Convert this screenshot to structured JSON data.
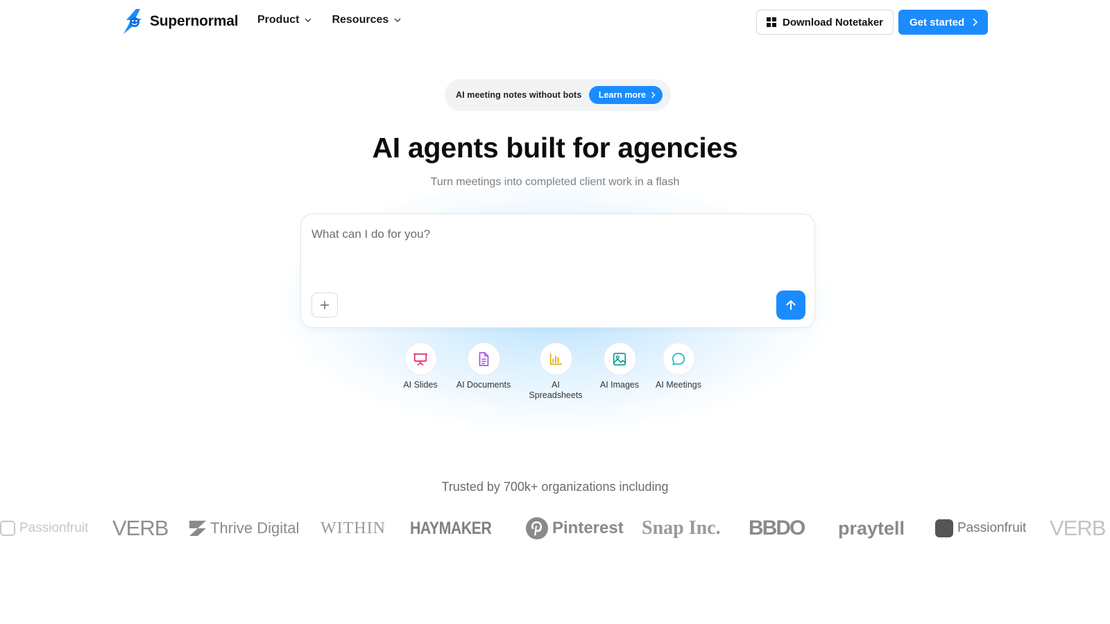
{
  "header": {
    "brand": "Supernormal",
    "menu": [
      {
        "label": "Product"
      },
      {
        "label": "Resources"
      }
    ],
    "download_label": "Download Notetaker",
    "get_started_label": "Get started"
  },
  "announcement": {
    "text": "AI meeting notes without bots",
    "button": "Learn more"
  },
  "hero": {
    "title": "AI agents built for agencies",
    "subtitle": "Turn meetings into completed client work in a flash"
  },
  "prompt": {
    "placeholder": "What can I do for you?"
  },
  "tools": [
    {
      "label": "AI Slides",
      "icon": "presentation-icon",
      "color": "#e0245e"
    },
    {
      "label": "AI Documents",
      "icon": "document-icon",
      "color": "#9b51e0"
    },
    {
      "label": "AI Spreadsheets",
      "icon": "bar-chart-icon",
      "color": "#e0a800"
    },
    {
      "label": "AI Images",
      "icon": "image-icon",
      "color": "#0f9d8a"
    },
    {
      "label": "AI Meetings",
      "icon": "chat-bubble-icon",
      "color": "#1fb6c9"
    }
  ],
  "trusted": {
    "text": "Trusted by 700k+ organizations including",
    "logos": [
      "Passionfruit",
      "VERB",
      "Thrive Digital",
      "WITHIN",
      "HAYMAKER",
      "Pinterest",
      "Snap Inc.",
      "BBDO",
      "praytell",
      "Passionfruit",
      "VERB"
    ]
  },
  "colors": {
    "accent": "#1a8cff"
  }
}
